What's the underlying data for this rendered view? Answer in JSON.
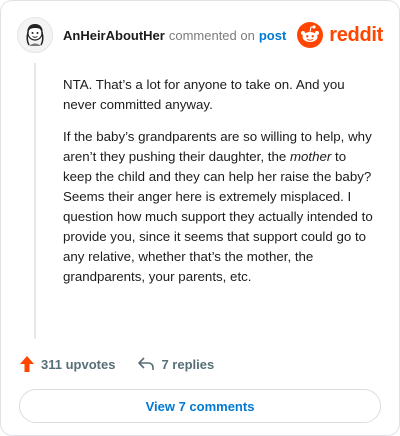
{
  "header": {
    "username": "AnHeirAboutHer",
    "action_text": "commented on",
    "post_link": "post",
    "logo_text": "reddit"
  },
  "comment": {
    "p1": "NTA. That’s a lot for anyone to take on. And you never committed anyway.",
    "p2_a": "If the baby’s grandparents are so willing to help, why aren’t they pushing their daughter, the ",
    "p2_em": "mother",
    "p2_b": " to keep the child and they can help her raise the baby? Seems their anger here is extremely misplaced. I question how much support they actually intended to provide you, since it seems that support could go to any relative, whether that’s the mother, the grandparents, your parents, etc."
  },
  "actions": {
    "upvotes": "311 upvotes",
    "replies": "7 replies"
  },
  "footer": {
    "view_comments": "View 7 comments"
  },
  "icons": {
    "avatar": "avatar-icon",
    "logo": "reddit-alien-icon",
    "upvote": "upvote-arrow-icon",
    "reply": "reply-arrow-icon"
  },
  "colors": {
    "brand": "#ff4500",
    "link": "#0079d3",
    "muted": "#7c7c7c"
  }
}
